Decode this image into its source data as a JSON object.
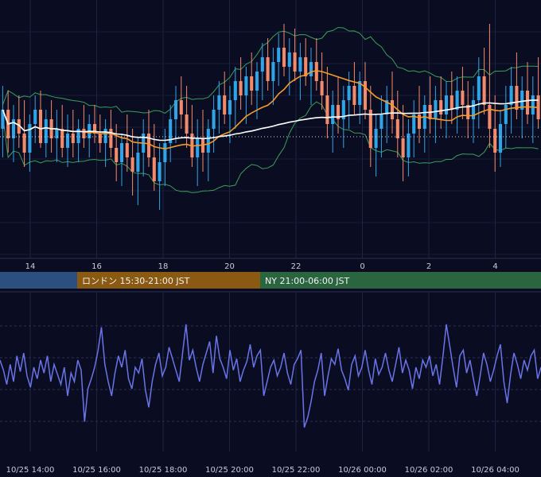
{
  "chart_data": [
    {
      "type": "candlestick",
      "panel": "price",
      "title": "",
      "xlabel": "",
      "ylabel": "",
      "x_tick_labels": [
        "14",
        "16",
        "18",
        "20",
        "22",
        "0",
        "2",
        "4"
      ],
      "grid": true,
      "colors": {
        "up": "#2fa4e7",
        "down": "#f28b6b",
        "bollinger": "#3a9e5a",
        "ma_short": "#f39a2a",
        "ma_long": "#ffffff",
        "reference_line": "#ffffff",
        "background": "#0a0d22"
      },
      "overlays": [
        "bollinger-bands",
        "moving-average-orange",
        "moving-average-white",
        "dotted-reference-line"
      ],
      "candles": [
        {
          "o": 0.52,
          "h": 0.7,
          "l": 0.4,
          "c": 0.6
        },
        {
          "o": 0.6,
          "h": 0.68,
          "l": 0.42,
          "c": 0.48
        },
        {
          "o": 0.48,
          "h": 0.62,
          "l": 0.38,
          "c": 0.56
        },
        {
          "o": 0.56,
          "h": 0.66,
          "l": 0.44,
          "c": 0.5
        },
        {
          "o": 0.5,
          "h": 0.64,
          "l": 0.36,
          "c": 0.42
        },
        {
          "o": 0.42,
          "h": 0.58,
          "l": 0.34,
          "c": 0.54
        },
        {
          "o": 0.54,
          "h": 0.66,
          "l": 0.46,
          "c": 0.6
        },
        {
          "o": 0.6,
          "h": 0.68,
          "l": 0.44,
          "c": 0.46
        },
        {
          "o": 0.46,
          "h": 0.6,
          "l": 0.4,
          "c": 0.56
        },
        {
          "o": 0.56,
          "h": 0.64,
          "l": 0.42,
          "c": 0.48
        },
        {
          "o": 0.48,
          "h": 0.6,
          "l": 0.38,
          "c": 0.52
        },
        {
          "o": 0.52,
          "h": 0.62,
          "l": 0.4,
          "c": 0.44
        },
        {
          "o": 0.44,
          "h": 0.58,
          "l": 0.36,
          "c": 0.5
        },
        {
          "o": 0.5,
          "h": 0.6,
          "l": 0.4,
          "c": 0.46
        },
        {
          "o": 0.46,
          "h": 0.56,
          "l": 0.38,
          "c": 0.52
        },
        {
          "o": 0.52,
          "h": 0.62,
          "l": 0.44,
          "c": 0.48
        },
        {
          "o": 0.48,
          "h": 0.58,
          "l": 0.4,
          "c": 0.54
        },
        {
          "o": 0.54,
          "h": 0.62,
          "l": 0.46,
          "c": 0.5
        },
        {
          "o": 0.5,
          "h": 0.58,
          "l": 0.42,
          "c": 0.46
        },
        {
          "o": 0.46,
          "h": 0.56,
          "l": 0.36,
          "c": 0.52
        },
        {
          "o": 0.52,
          "h": 0.6,
          "l": 0.4,
          "c": 0.44
        },
        {
          "o": 0.44,
          "h": 0.54,
          "l": 0.3,
          "c": 0.38
        },
        {
          "o": 0.38,
          "h": 0.5,
          "l": 0.28,
          "c": 0.46
        },
        {
          "o": 0.46,
          "h": 0.58,
          "l": 0.34,
          "c": 0.4
        },
        {
          "o": 0.4,
          "h": 0.52,
          "l": 0.24,
          "c": 0.34
        },
        {
          "o": 0.34,
          "h": 0.48,
          "l": 0.2,
          "c": 0.42
        },
        {
          "o": 0.42,
          "h": 0.56,
          "l": 0.32,
          "c": 0.5
        },
        {
          "o": 0.5,
          "h": 0.6,
          "l": 0.36,
          "c": 0.4
        },
        {
          "o": 0.4,
          "h": 0.54,
          "l": 0.26,
          "c": 0.3
        },
        {
          "o": 0.3,
          "h": 0.46,
          "l": 0.18,
          "c": 0.38
        },
        {
          "o": 0.38,
          "h": 0.52,
          "l": 0.28,
          "c": 0.46
        },
        {
          "o": 0.46,
          "h": 0.62,
          "l": 0.38,
          "c": 0.56
        },
        {
          "o": 0.56,
          "h": 0.7,
          "l": 0.46,
          "c": 0.64
        },
        {
          "o": 0.64,
          "h": 0.74,
          "l": 0.52,
          "c": 0.58
        },
        {
          "o": 0.58,
          "h": 0.7,
          "l": 0.44,
          "c": 0.5
        },
        {
          "o": 0.5,
          "h": 0.62,
          "l": 0.36,
          "c": 0.4
        },
        {
          "o": 0.4,
          "h": 0.56,
          "l": 0.28,
          "c": 0.48
        },
        {
          "o": 0.48,
          "h": 0.6,
          "l": 0.34,
          "c": 0.42
        },
        {
          "o": 0.42,
          "h": 0.56,
          "l": 0.3,
          "c": 0.52
        },
        {
          "o": 0.52,
          "h": 0.66,
          "l": 0.42,
          "c": 0.6
        },
        {
          "o": 0.6,
          "h": 0.72,
          "l": 0.5,
          "c": 0.66
        },
        {
          "o": 0.66,
          "h": 0.76,
          "l": 0.54,
          "c": 0.58
        },
        {
          "o": 0.58,
          "h": 0.7,
          "l": 0.46,
          "c": 0.64
        },
        {
          "o": 0.64,
          "h": 0.78,
          "l": 0.52,
          "c": 0.72
        },
        {
          "o": 0.72,
          "h": 0.82,
          "l": 0.6,
          "c": 0.66
        },
        {
          "o": 0.66,
          "h": 0.78,
          "l": 0.54,
          "c": 0.74
        },
        {
          "o": 0.74,
          "h": 0.84,
          "l": 0.62,
          "c": 0.68
        },
        {
          "o": 0.68,
          "h": 0.8,
          "l": 0.56,
          "c": 0.76
        },
        {
          "o": 0.76,
          "h": 0.88,
          "l": 0.64,
          "c": 0.82
        },
        {
          "o": 0.82,
          "h": 0.9,
          "l": 0.68,
          "c": 0.72
        },
        {
          "o": 0.72,
          "h": 0.86,
          "l": 0.62,
          "c": 0.8
        },
        {
          "o": 0.8,
          "h": 0.92,
          "l": 0.7,
          "c": 0.86
        },
        {
          "o": 0.86,
          "h": 0.96,
          "l": 0.74,
          "c": 0.78
        },
        {
          "o": 0.78,
          "h": 0.9,
          "l": 0.66,
          "c": 0.84
        },
        {
          "o": 0.84,
          "h": 0.94,
          "l": 0.72,
          "c": 0.76
        },
        {
          "o": 0.76,
          "h": 0.88,
          "l": 0.64,
          "c": 0.82
        },
        {
          "o": 0.82,
          "h": 0.9,
          "l": 0.7,
          "c": 0.74
        },
        {
          "o": 0.74,
          "h": 0.86,
          "l": 0.62,
          "c": 0.8
        },
        {
          "o": 0.8,
          "h": 0.9,
          "l": 0.68,
          "c": 0.72
        },
        {
          "o": 0.72,
          "h": 0.84,
          "l": 0.6,
          "c": 0.66
        },
        {
          "o": 0.66,
          "h": 0.78,
          "l": 0.48,
          "c": 0.54
        },
        {
          "o": 0.54,
          "h": 0.68,
          "l": 0.42,
          "c": 0.62
        },
        {
          "o": 0.62,
          "h": 0.74,
          "l": 0.5,
          "c": 0.56
        },
        {
          "o": 0.56,
          "h": 0.7,
          "l": 0.44,
          "c": 0.64
        },
        {
          "o": 0.64,
          "h": 0.76,
          "l": 0.52,
          "c": 0.7
        },
        {
          "o": 0.7,
          "h": 0.8,
          "l": 0.58,
          "c": 0.62
        },
        {
          "o": 0.62,
          "h": 0.76,
          "l": 0.54,
          "c": 0.72
        },
        {
          "o": 0.72,
          "h": 0.8,
          "l": 0.56,
          "c": 0.6
        },
        {
          "o": 0.6,
          "h": 0.7,
          "l": 0.36,
          "c": 0.44
        },
        {
          "o": 0.44,
          "h": 0.58,
          "l": 0.32,
          "c": 0.52
        },
        {
          "o": 0.52,
          "h": 0.66,
          "l": 0.4,
          "c": 0.58
        },
        {
          "o": 0.58,
          "h": 0.7,
          "l": 0.46,
          "c": 0.64
        },
        {
          "o": 0.64,
          "h": 0.76,
          "l": 0.5,
          "c": 0.56
        },
        {
          "o": 0.56,
          "h": 0.68,
          "l": 0.4,
          "c": 0.48
        },
        {
          "o": 0.48,
          "h": 0.62,
          "l": 0.3,
          "c": 0.4
        },
        {
          "o": 0.4,
          "h": 0.56,
          "l": 0.32,
          "c": 0.5
        },
        {
          "o": 0.5,
          "h": 0.64,
          "l": 0.4,
          "c": 0.58
        },
        {
          "o": 0.58,
          "h": 0.7,
          "l": 0.46,
          "c": 0.52
        },
        {
          "o": 0.52,
          "h": 0.66,
          "l": 0.42,
          "c": 0.62
        },
        {
          "o": 0.62,
          "h": 0.74,
          "l": 0.5,
          "c": 0.56
        },
        {
          "o": 0.56,
          "h": 0.7,
          "l": 0.46,
          "c": 0.64
        },
        {
          "o": 0.64,
          "h": 0.74,
          "l": 0.52,
          "c": 0.58
        },
        {
          "o": 0.58,
          "h": 0.72,
          "l": 0.48,
          "c": 0.66
        },
        {
          "o": 0.66,
          "h": 0.76,
          "l": 0.54,
          "c": 0.6
        },
        {
          "o": 0.6,
          "h": 0.74,
          "l": 0.5,
          "c": 0.68
        },
        {
          "o": 0.68,
          "h": 0.78,
          "l": 0.56,
          "c": 0.62
        },
        {
          "o": 0.62,
          "h": 0.72,
          "l": 0.48,
          "c": 0.56
        },
        {
          "o": 0.56,
          "h": 0.7,
          "l": 0.46,
          "c": 0.64
        },
        {
          "o": 0.64,
          "h": 0.82,
          "l": 0.52,
          "c": 0.74
        },
        {
          "o": 0.74,
          "h": 0.86,
          "l": 0.58,
          "c": 0.62
        },
        {
          "o": 0.62,
          "h": 0.96,
          "l": 0.44,
          "c": 0.52
        },
        {
          "o": 0.52,
          "h": 0.66,
          "l": 0.34,
          "c": 0.42
        },
        {
          "o": 0.42,
          "h": 0.6,
          "l": 0.36,
          "c": 0.54
        },
        {
          "o": 0.54,
          "h": 0.7,
          "l": 0.44,
          "c": 0.62
        },
        {
          "o": 0.62,
          "h": 0.78,
          "l": 0.5,
          "c": 0.7
        },
        {
          "o": 0.7,
          "h": 0.84,
          "l": 0.56,
          "c": 0.6
        },
        {
          "o": 0.6,
          "h": 0.74,
          "l": 0.48,
          "c": 0.68
        },
        {
          "o": 0.68,
          "h": 0.8,
          "l": 0.54,
          "c": 0.58
        },
        {
          "o": 0.58,
          "h": 0.74,
          "l": 0.46,
          "c": 0.66
        },
        {
          "o": 0.66,
          "h": 0.82,
          "l": 0.52,
          "c": 0.56
        }
      ]
    },
    {
      "type": "line",
      "panel": "oscillator",
      "title": "",
      "xlabel": "",
      "ylabel": "",
      "x_tick_labels": [
        "10/25 14:00",
        "10/25 16:00",
        "10/25 18:00",
        "10/25 20:00",
        "10/25 22:00",
        "10/26 00:00",
        "10/26 02:00",
        "10/26 04:00"
      ],
      "color": "#6a73e8",
      "values": [
        0.55,
        0.48,
        0.38,
        0.52,
        0.4,
        0.58,
        0.47,
        0.6,
        0.44,
        0.36,
        0.5,
        0.42,
        0.55,
        0.46,
        0.58,
        0.4,
        0.52,
        0.45,
        0.38,
        0.5,
        0.3,
        0.46,
        0.4,
        0.55,
        0.48,
        0.12,
        0.35,
        0.42,
        0.5,
        0.62,
        0.78,
        0.52,
        0.4,
        0.3,
        0.46,
        0.58,
        0.5,
        0.62,
        0.42,
        0.35,
        0.5,
        0.46,
        0.56,
        0.34,
        0.22,
        0.4,
        0.52,
        0.6,
        0.44,
        0.5,
        0.64,
        0.56,
        0.48,
        0.4,
        0.6,
        0.8,
        0.55,
        0.62,
        0.5,
        0.4,
        0.52,
        0.6,
        0.68,
        0.46,
        0.72,
        0.56,
        0.5,
        0.42,
        0.62,
        0.48,
        0.56,
        0.4,
        0.48,
        0.54,
        0.66,
        0.5,
        0.58,
        0.62,
        0.3,
        0.4,
        0.5,
        0.55,
        0.44,
        0.5,
        0.6,
        0.46,
        0.38,
        0.52,
        0.56,
        0.62,
        0.08,
        0.15,
        0.26,
        0.4,
        0.48,
        0.6,
        0.3,
        0.44,
        0.56,
        0.52,
        0.63,
        0.48,
        0.42,
        0.34,
        0.52,
        0.58,
        0.44,
        0.5,
        0.62,
        0.48,
        0.38,
        0.56,
        0.45,
        0.5,
        0.6,
        0.48,
        0.4,
        0.52,
        0.64,
        0.46,
        0.55,
        0.48,
        0.35,
        0.5,
        0.42,
        0.55,
        0.5,
        0.58,
        0.44,
        0.52,
        0.38,
        0.58,
        0.8,
        0.65,
        0.5,
        0.36,
        0.58,
        0.62,
        0.46,
        0.55,
        0.42,
        0.3,
        0.44,
        0.6,
        0.52,
        0.4,
        0.48,
        0.58,
        0.66,
        0.4,
        0.25,
        0.45,
        0.6,
        0.52,
        0.42,
        0.55,
        0.48,
        0.58,
        0.62,
        0.42,
        0.5
      ]
    }
  ],
  "sessions": [
    {
      "label": "",
      "color": "#2b4f7e"
    },
    {
      "label": "ロンドン 15:30-21:00 JST",
      "color": "#8a5a12"
    },
    {
      "label": "NY 21:00-06:00 JST",
      "color": "#2a6540"
    }
  ]
}
